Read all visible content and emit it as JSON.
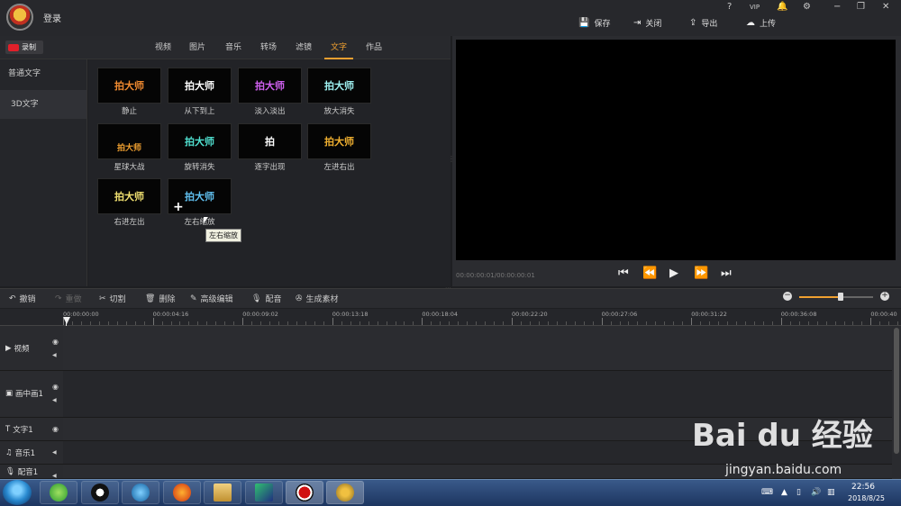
{
  "app": {
    "login": "登录",
    "window_controls": [
      "?",
      "VIP",
      "铃",
      "设置",
      "−",
      "❐",
      "✕"
    ],
    "actions": [
      {
        "icon": "save-icon",
        "label": "保存"
      },
      {
        "icon": "close-door-icon",
        "label": "关闭"
      },
      {
        "icon": "export-icon",
        "label": "导出"
      },
      {
        "icon": "upload-icon",
        "label": "上传"
      }
    ]
  },
  "record_label": "录制",
  "tabs": [
    "视频",
    "图片",
    "音乐",
    "转场",
    "滤镜",
    "文字",
    "作品"
  ],
  "active_tab": "文字",
  "side_categories": [
    "普通文字",
    "3D文字"
  ],
  "selected_side": "3D文字",
  "effects": [
    {
      "thumb_text": "拍大师",
      "color": "#f08a30",
      "label": "静止"
    },
    {
      "thumb_text": "拍大师",
      "color": "#ffffff",
      "label": "从下到上"
    },
    {
      "thumb_text": "拍大师",
      "color": "#d060f0",
      "label": "淡入淡出"
    },
    {
      "thumb_text": "拍大师",
      "color": "#9ef0f0",
      "label": "放大消失"
    },
    {
      "thumb_text": "拍大师",
      "color": "#f0a030",
      "label": "星球大战"
    },
    {
      "thumb_text": "拍大师",
      "color": "#50e0d0",
      "label": "旋转消失"
    },
    {
      "thumb_text": "拍",
      "color": "#ffffff",
      "label": "逐字出现"
    },
    {
      "thumb_text": "拍大师",
      "color": "#f0b030",
      "label": "左进右出"
    },
    {
      "thumb_text": "拍大师",
      "color": "#f0e070",
      "label": "右进左出"
    },
    {
      "thumb_text": "拍大师",
      "color": "#60c0f0",
      "label": "左右缩放"
    }
  ],
  "tooltip": "左右缩放",
  "preview": {
    "timecode": "00:00:00:01/00:00:00:01",
    "controls": [
      "⏮",
      "⏪",
      "▶",
      "⏩",
      "⏭"
    ]
  },
  "toolbar": [
    {
      "icon": "undo-icon",
      "label": "撤销",
      "enabled": true
    },
    {
      "icon": "redo-icon",
      "label": "重做",
      "enabled": false
    },
    {
      "icon": "scissors-icon",
      "label": "切割",
      "enabled": true
    },
    {
      "icon": "trash-icon",
      "label": "删除",
      "enabled": true
    },
    {
      "icon": "pencil-icon",
      "label": "高级编辑",
      "enabled": true
    },
    {
      "icon": "microphone-icon",
      "label": "配音",
      "enabled": true
    },
    {
      "icon": "film-reel-icon",
      "label": "生成素材",
      "enabled": true
    }
  ],
  "zoom_level": 0.56,
  "ruler": [
    "00:00:00:00",
    "00:00:04:16",
    "00:00:09:02",
    "00:00:13:18",
    "00:00:18:04",
    "00:00:22:20",
    "00:00:27:06",
    "00:00:31:22",
    "00:00:36:08",
    "00:00:40"
  ],
  "tracks": [
    {
      "icon": "play-square-icon",
      "name": "视频",
      "eye": true,
      "speaker": true
    },
    {
      "icon": "pip-icon",
      "name": "画中画1",
      "eye": true,
      "speaker": true
    },
    {
      "icon": "text-t-icon",
      "name": "文字1",
      "eye": true,
      "speaker": false
    },
    {
      "icon": "music-note-icon",
      "name": "音乐1",
      "eye": false,
      "speaker": true
    },
    {
      "icon": "microphone-icon",
      "name": "配音1",
      "eye": false,
      "speaker": true
    }
  ],
  "taskbar": {
    "time": "22:56",
    "date": "2018/8/25",
    "apps": [
      "360-browser-icon",
      "qq-icon",
      "media-player-icon",
      "firefox-icon",
      "file-explorer-icon",
      "screen-recorder-icon",
      "record-icon",
      "pai-da-shi-icon"
    ]
  },
  "watermark": {
    "logo": "Bai du 经验",
    "url": "jingyan.baidu.com"
  }
}
